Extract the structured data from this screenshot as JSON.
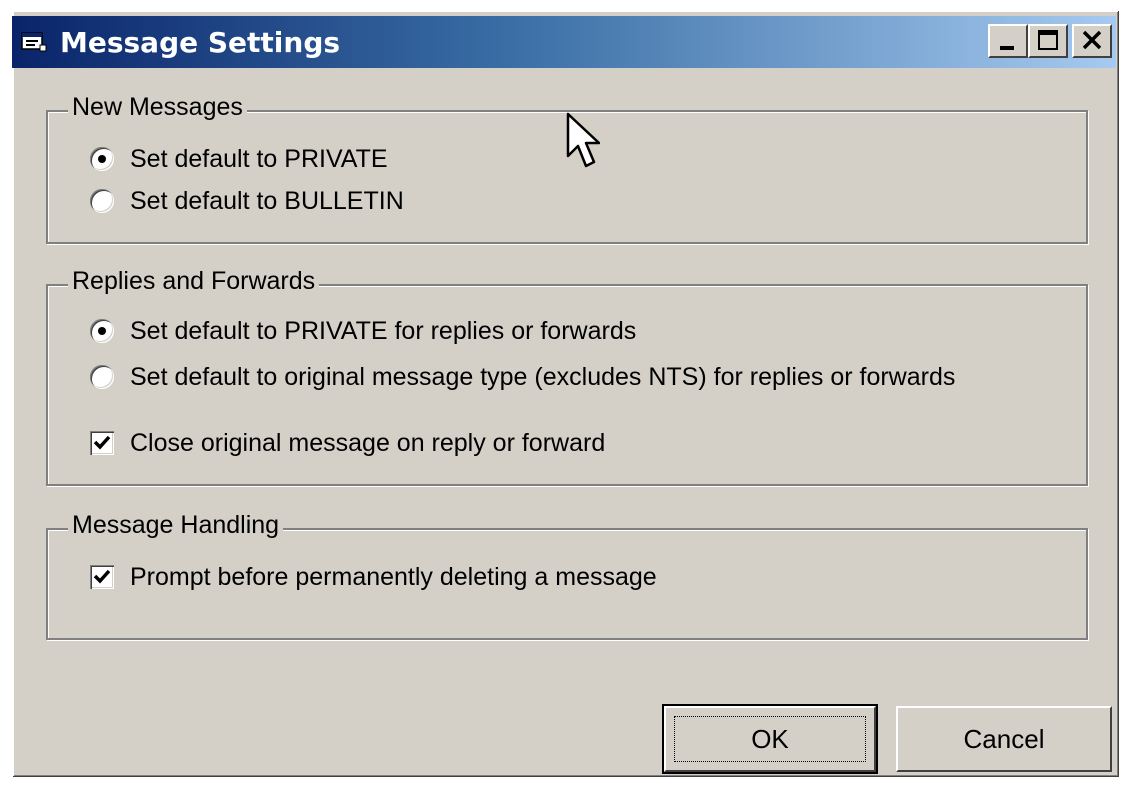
{
  "window": {
    "title": "Message Settings",
    "icon": "message-window-icon",
    "title_gradient": [
      "#0a246a",
      "#a6caf0"
    ]
  },
  "caption_buttons": {
    "minimize": "minimize-icon",
    "maximize": "maximize-icon",
    "close": "close-icon"
  },
  "groups": {
    "new_messages": {
      "legend": "New Messages",
      "options": [
        {
          "label": "Set default to PRIVATE",
          "selected": true
        },
        {
          "label": "Set default to BULLETIN",
          "selected": false
        }
      ]
    },
    "replies": {
      "legend": "Replies and Forwards",
      "options": [
        {
          "label": "Set default to PRIVATE for replies or forwards",
          "selected": true
        },
        {
          "label": "Set default to original message type (excludes NTS) for replies or forwards",
          "selected": false
        }
      ],
      "checkbox": {
        "label": "Close original message on reply or forward",
        "checked": true
      }
    },
    "handling": {
      "legend": "Message Handling",
      "checkbox": {
        "label": "Prompt before permanently deleting a message",
        "checked": true
      }
    }
  },
  "buttons": {
    "ok": "OK",
    "cancel": "Cancel"
  }
}
